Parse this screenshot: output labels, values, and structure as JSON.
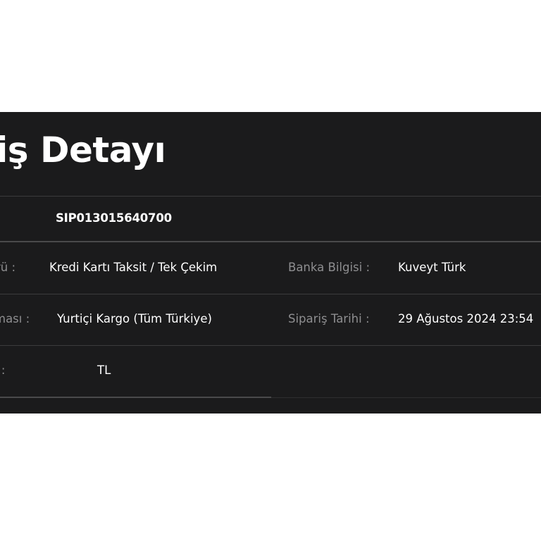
{
  "order_detail": {
    "title": "riş Detayı",
    "order_code": "SIP013015640700",
    "rows": [
      {
        "left_label": "rü :",
        "left_value": "Kredi Kartı Taksit / Tek Çekim",
        "right_label": "Banka Bilgisi :",
        "right_value": "Kuveyt Türk"
      },
      {
        "left_label": "ması :",
        "left_value": "Yurtiçi Kargo (Tüm Türkiye)",
        "right_label": "Sipariş Tarihi :",
        "right_value": "29 Ağustos 2024 23:54"
      },
      {
        "left_label": "i :",
        "left_value": "TL"
      }
    ]
  },
  "colors": {
    "panel_background": "#1b1b1c",
    "divider": "#3c3c3d",
    "label_text": "#8e8e90",
    "value_text": "#ffffff",
    "page_background": "#ffffff"
  }
}
